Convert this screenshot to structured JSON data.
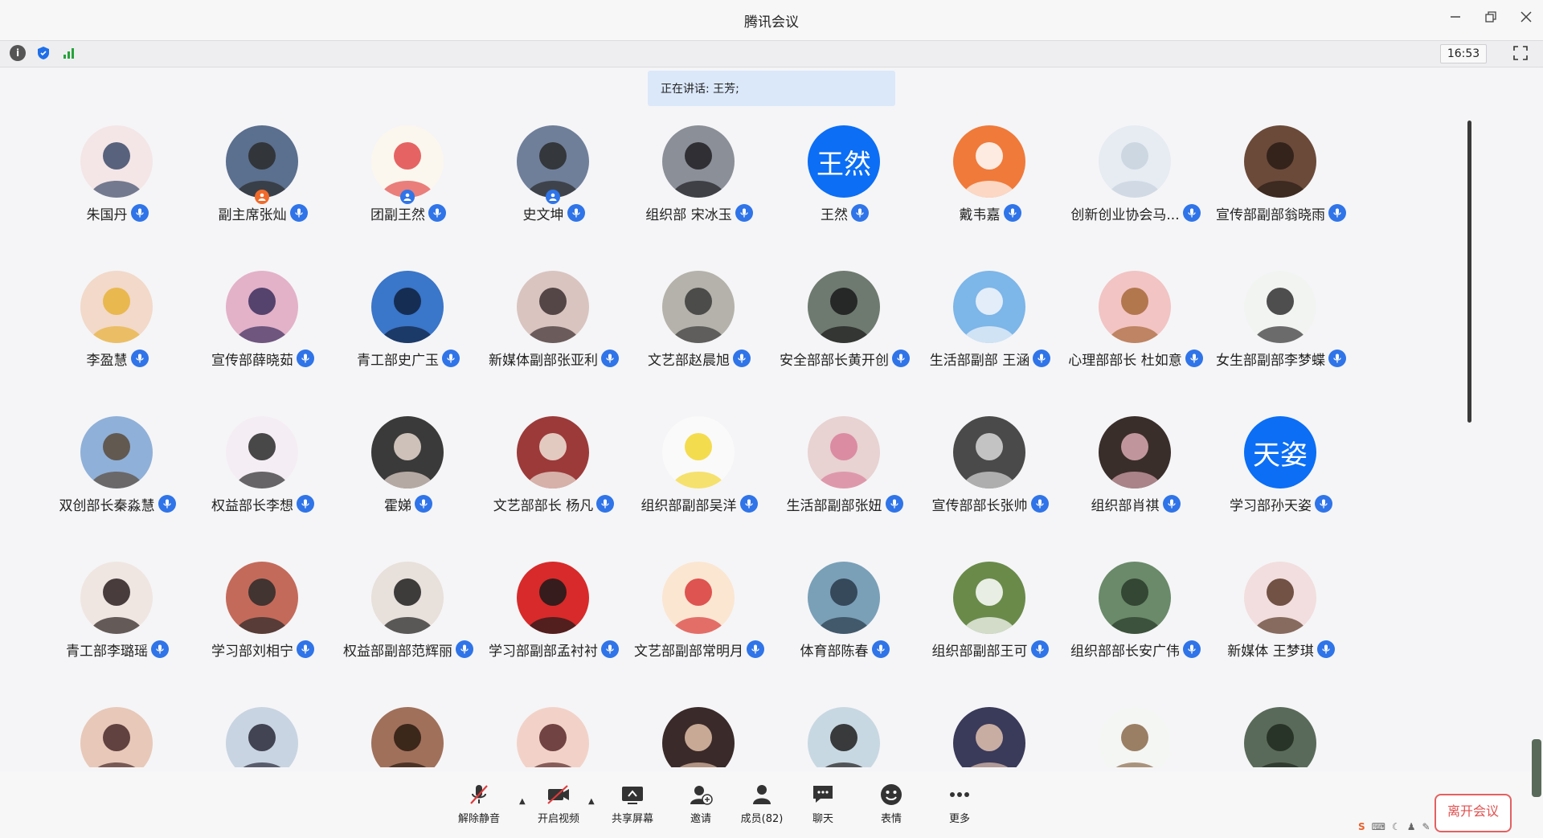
{
  "window": {
    "title": "腾讯会议",
    "clock": "16:53"
  },
  "speaking": {
    "label": "正在讲话: 王芳;"
  },
  "participants": [
    {
      "name": "朱国丹",
      "bg": "#f4e6e6",
      "fg": "#3c4a6a"
    },
    {
      "name": "副主席张灿",
      "bg": "#5b6f8e",
      "fg": "#2b2b2b",
      "badge": "#f06a2a"
    },
    {
      "name": "团副王然",
      "bg": "#fbf7ee",
      "fg": "#e14a4a",
      "badge": "#2f74e8"
    },
    {
      "name": "史文坤",
      "bg": "#6f7f9a",
      "fg": "#2a2a2a",
      "badge": "#2f74e8"
    },
    {
      "name": "组织部 宋冰玉",
      "bg": "#8a8f98",
      "fg": "#1e1e22"
    },
    {
      "name": "王然",
      "text": "王然"
    },
    {
      "name": "戴韦嘉",
      "bg": "#f07a3a",
      "fg": "#ffffff"
    },
    {
      "name": "创新创业协会马...",
      "bg": "#e6ecf2",
      "fg": "#c8d3de"
    },
    {
      "name": "宣传部副部翁晓雨",
      "bg": "#6b4a3a",
      "fg": "#2a1c16"
    },
    {
      "name": "李盈慧",
      "bg": "#f2d9c9",
      "fg": "#e8b23a"
    },
    {
      "name": "宣传部薛晓茹",
      "bg": "#e3b2c8",
      "fg": "#3c2f5e"
    },
    {
      "name": "青工部史广玉",
      "bg": "#3a76c9",
      "fg": "#10213e"
    },
    {
      "name": "新媒体副部张亚利",
      "bg": "#d9c4c0",
      "fg": "#3c3030"
    },
    {
      "name": "文艺部赵晨旭",
      "bg": "#b4b2aa",
      "fg": "#3a3a3a"
    },
    {
      "name": "安全部部长黄开创",
      "bg": "#6e7a70",
      "fg": "#1a1a1a"
    },
    {
      "name": "生活部副部 王涵",
      "bg": "#7db6e8",
      "fg": "#f4f7fb"
    },
    {
      "name": "心理部部长 杜如意",
      "bg": "#f2c4c4",
      "fg": "#a86a3a"
    },
    {
      "name": "女生部副部李梦蝶",
      "bg": "#f2f4f2",
      "fg": "#303030"
    },
    {
      "name": "双创部长秦淼慧",
      "bg": "#8fb0d8",
      "fg": "#5a4a3a"
    },
    {
      "name": "权益部长李想",
      "bg": "#f4eef4",
      "fg": "#2a2a2a"
    },
    {
      "name": "霍娣",
      "bg": "#3a3a3a",
      "fg": "#e9d9d0"
    },
    {
      "name": "文艺部部长 杨凡",
      "bg": "#9c3a3a",
      "fg": "#f0e4d8"
    },
    {
      "name": "组织部副部吴洋",
      "bg": "#fafafa",
      "fg": "#f2d630"
    },
    {
      "name": "生活部副部张妞",
      "bg": "#e8d2d2",
      "fg": "#d8809a"
    },
    {
      "name": "宣传部部长张帅",
      "bg": "#4a4a4a",
      "fg": "#d8d8d8"
    },
    {
      "name": "组织部肖祺",
      "bg": "#3a2e2a",
      "fg": "#d8a8b0"
    },
    {
      "name": "学习部孙天姿",
      "text": "天姿"
    },
    {
      "name": "青工部李璐瑶",
      "bg": "#efe6e2",
      "fg": "#2a1e1e"
    },
    {
      "name": "学习部刘相宁",
      "bg": "#c46a5a",
      "fg": "#2a2a2a"
    },
    {
      "name": "权益部副部范辉丽",
      "bg": "#e8e0da",
      "fg": "#1e1e1e"
    },
    {
      "name": "学习部副部孟衬衬",
      "bg": "#d82a2a",
      "fg": "#1a1a1a"
    },
    {
      "name": "文艺部副部常明月",
      "bg": "#fbe6d2",
      "fg": "#d83a3a"
    },
    {
      "name": "体育部陈春",
      "bg": "#7aa0b8",
      "fg": "#2a3a4a"
    },
    {
      "name": "组织部副部王可",
      "bg": "#6a8a4a",
      "fg": "#ffffff"
    },
    {
      "name": "组织部部长安广伟",
      "bg": "#6a8a6a",
      "fg": "#2a3a2a"
    },
    {
      "name": "新媒体 王梦琪",
      "bg": "#f2dede",
      "fg": "#5a3a2a"
    },
    {
      "name": "",
      "bg": "#e8c8b8",
      "fg": "#4a2a2a"
    },
    {
      "name": "",
      "bg": "#c8d4e2",
      "fg": "#2a2a3a"
    },
    {
      "name": "",
      "bg": "#a0705a",
      "fg": "#2a1a10"
    },
    {
      "name": "",
      "bg": "#f2d2c8",
      "fg": "#5a2a2a"
    },
    {
      "name": "",
      "bg": "#3a2a2a",
      "fg": "#e2c0a8"
    },
    {
      "name": "",
      "bg": "#c8d8e2",
      "fg": "#1e1e1e"
    },
    {
      "name": "",
      "bg": "#3a3a5a",
      "fg": "#e2c2b0"
    },
    {
      "name": "",
      "bg": "#f4f6f4",
      "fg": "#8a6a4a"
    },
    {
      "name": "",
      "bg": "#5a6a5a",
      "fg": "#1e2a1e"
    }
  ],
  "controls": {
    "unmute": "解除静音",
    "video": "开启视频",
    "share": "共享屏幕",
    "invite": "邀请",
    "members": "成员(82)",
    "chat": "聊天",
    "reactions": "表情",
    "more": "更多",
    "leave": "离开会议"
  },
  "colors": {
    "accent": "#0b6ef5",
    "mic": "#2f74e8",
    "leave": "#e05050"
  },
  "icons": {
    "info": "info-icon",
    "shield": "shield-icon",
    "signal": "signal-icon",
    "fullscreen": "fullscreen-icon",
    "minimize": "minimize-icon",
    "restore": "restore-icon",
    "close": "close-icon"
  }
}
